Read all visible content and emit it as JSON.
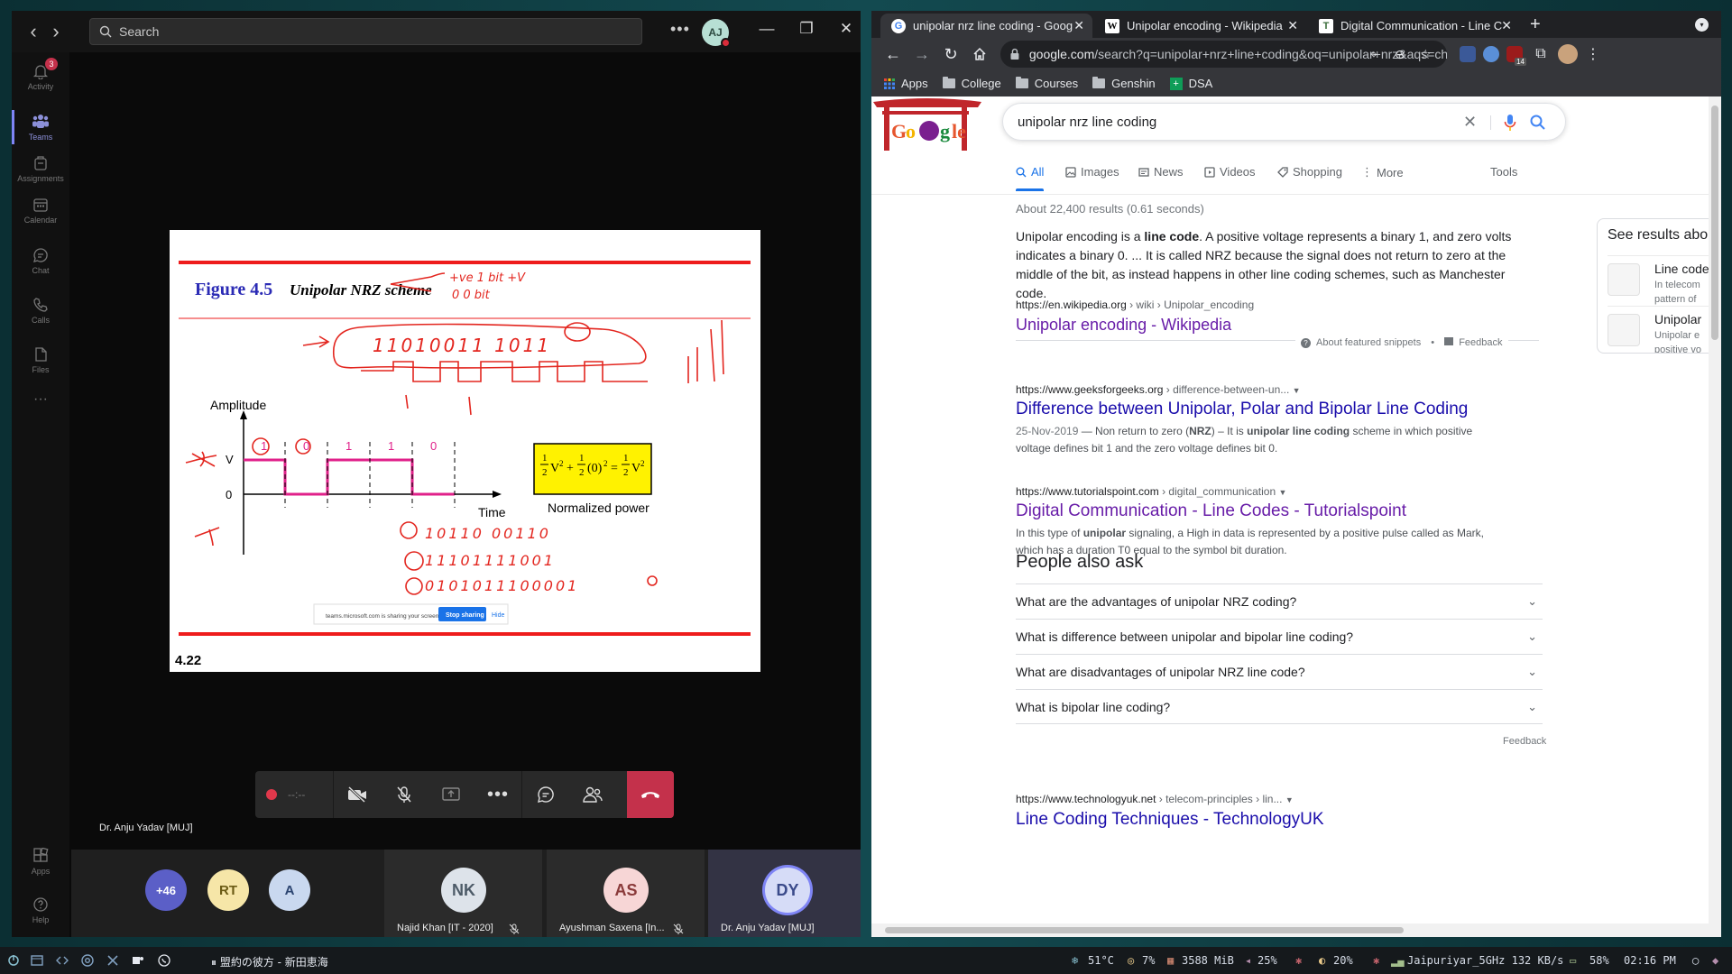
{
  "teams": {
    "search_placeholder": "Search",
    "avatar_initials": "AJ",
    "rail": [
      {
        "label": "Activity",
        "badge": "3"
      },
      {
        "label": "Teams"
      },
      {
        "label": "Assignments"
      },
      {
        "label": "Calendar"
      },
      {
        "label": "Chat"
      },
      {
        "label": "Calls"
      },
      {
        "label": "Files"
      },
      {
        "label": "Apps"
      },
      {
        "label": "Help"
      }
    ],
    "slide": {
      "figure_number": "Figure 4.5",
      "figure_title": "Unipolar NRZ scheme",
      "amplitude_label": "Amplitude",
      "time_label": "Time",
      "v_label": "V",
      "zero_label": "0",
      "bits": [
        "1",
        "0",
        "1",
        "1",
        "0"
      ],
      "formula_caption": "Normalized power",
      "page_number": "4.22",
      "share_text": "teams.microsoft.com is sharing your screen.",
      "stop_sharing": "Stop sharing",
      "hide": "Hide",
      "annotations": {
        "note1": "+ve  1 bit  +V",
        "note2": "0   0 bit",
        "bits_top": "11010011  1011",
        "row1": "10110 00110",
        "row2": "11101111001",
        "row3": "0101011100001"
      }
    },
    "presenter_name": "Dr. Anju Yadav [MUJ]",
    "call_timer": "--:--",
    "participants_overflow": "+46",
    "small_avatars": [
      {
        "initials": "RT",
        "bg": "#f6e6a8",
        "fg": "#6b5b15"
      },
      {
        "initials": "A",
        "bg": "#c9d8ef",
        "fg": "#2b4470"
      }
    ],
    "tiles": [
      {
        "initials": "NK",
        "name": "Najid Khan [IT - 2020]",
        "bg": "#dde3ea",
        "fg": "#4d5b68"
      },
      {
        "initials": "AS",
        "name": "Ayushman Saxena [In...",
        "bg": "#f7d6d6",
        "fg": "#8a3a3a"
      },
      {
        "initials": "DY",
        "name": "Dr. Anju Yadav [MUJ]",
        "bg": "#d6dcf7",
        "fg": "#3a4a8a"
      }
    ]
  },
  "chrome": {
    "tabs": [
      {
        "title": "unipolar nrz line coding - Goog",
        "favicon": "G"
      },
      {
        "title": "Unipolar encoding - Wikipedia",
        "favicon": "W"
      },
      {
        "title": "Digital Communication - Line C",
        "favicon": "T"
      }
    ],
    "omnibox_host": "google.com",
    "omnibox_path": "/search?q=unipolar+nrz+line+coding&oq=unipolar+nrz&aqs=chro...",
    "ext_badge": "14",
    "bookmarks": [
      "Apps",
      "College",
      "Courses",
      "Genshin",
      "DSA"
    ]
  },
  "google": {
    "query": "unipolar nrz line coding",
    "tabs": [
      "All",
      "Images",
      "News",
      "Videos",
      "Shopping",
      "More"
    ],
    "tools": "Tools",
    "stats": "About 22,400 results (0.61 seconds)",
    "snippet": {
      "p1": "Unipolar encoding is a ",
      "bold1": "line code",
      "p2": ". A positive voltage represents a binary 1, and zero volts indicates a binary 0. ... It is called NRZ because the signal does not return to zero at the middle of the bit, as instead happens in other line coding schemes, such as Manchester code.",
      "url_host": "https://en.wikipedia.org",
      "url_path": " › wiki › Unipolar_encoding",
      "title": "Unipolar encoding - Wikipedia",
      "about": "About featured snippets",
      "feedback": "Feedback"
    },
    "results": [
      {
        "host": "https://www.geeksforgeeks.org",
        "path": " › difference-between-un...",
        "title": "Difference between Unipolar, Polar and Bipolar Line Coding",
        "date": "25-Nov-2019",
        "desc_a": " — Non return to zero (",
        "desc_b": "NRZ",
        "desc_c": ") – It is ",
        "desc_d": "unipolar line coding",
        "desc_e": " scheme in which positive voltage defines bit 1 and the zero voltage defines bit 0."
      },
      {
        "host": "https://www.tutorialspoint.com",
        "path": " › digital_communication",
        "title": "Digital Communication - Line Codes - Tutorialspoint",
        "desc_a": "In this type of ",
        "desc_b": "unipolar",
        "desc_c": " signaling, a High in data is represented by a positive pulse called as Mark, which has a duration T0 equal to the symbol bit duration."
      },
      {
        "host": "https://www.technologyuk.net",
        "path": " › telecom-principles › lin...",
        "title": "Line Coding Techniques - TechnologyUK"
      }
    ],
    "paa_title": "People also ask",
    "paa": [
      "What are the advantages of unipolar NRZ coding?",
      "What is difference between unipolar and bipolar line coding?",
      "What are disadvantages of unipolar NRZ line code?",
      "What is bipolar line coding?"
    ],
    "paa_feedback": "Feedback",
    "side": {
      "heading": "See results abo",
      "items": [
        {
          "title": "Line code",
          "l1": "In telecom",
          "l2": "pattern of"
        },
        {
          "title": "Unipolar",
          "l1": "Unipolar e",
          "l2": "positive vo"
        }
      ]
    }
  },
  "taskbar": {
    "media": "⏸ 盟約の彼方 - 新田恵海",
    "temp": "51°C",
    "cpu": "7%",
    "mem": "3588 MiB",
    "volume": "25%",
    "brightness": "20%",
    "wifi": "Jaipuriyar_5GHz 132 KB/s",
    "battery": "58%",
    "clock": "02:16 PM"
  }
}
